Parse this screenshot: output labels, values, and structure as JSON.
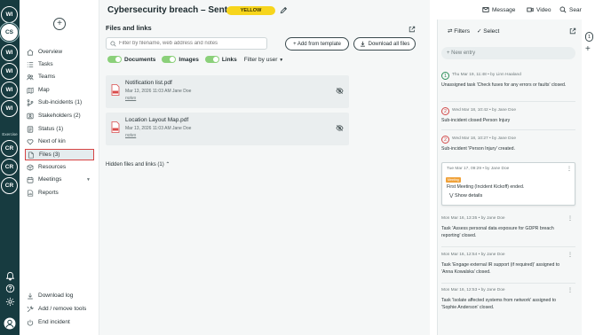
{
  "rail": {
    "avatars_top": [
      "WI",
      "CS",
      "WI",
      "WI",
      "WI",
      "WI"
    ],
    "exercise_label": "Exercise",
    "avatars_exercise": [
      "CR",
      "CR",
      "CR"
    ]
  },
  "sidebar": {
    "items": [
      {
        "label": "Overview",
        "icon": "home-icon"
      },
      {
        "label": "Tasks",
        "icon": "list-icon"
      },
      {
        "label": "Teams",
        "icon": "users-icon"
      },
      {
        "label": "Map",
        "icon": "map-icon"
      },
      {
        "label": "Sub-incidents (1)",
        "icon": "branch-icon"
      },
      {
        "label": "Stakeholders (2)",
        "icon": "stakeholders-icon"
      },
      {
        "label": "Status (1)",
        "icon": "status-icon"
      },
      {
        "label": "Next of kin",
        "icon": "heart-icon"
      },
      {
        "label": "Files (3)",
        "icon": "file-icon"
      },
      {
        "label": "Resources",
        "icon": "box-icon"
      },
      {
        "label": "Meetings",
        "icon": "calendar-icon"
      },
      {
        "label": "Reports",
        "icon": "report-icon"
      }
    ],
    "bottom": [
      {
        "label": "Download log",
        "icon": "download-icon"
      },
      {
        "label": "Add / remove tools",
        "icon": "tools-icon"
      },
      {
        "label": "End incident",
        "icon": "power-icon"
      }
    ]
  },
  "header": {
    "title": "Cybersecurity breach – SentraC...",
    "status_badge": "YELLOW",
    "message": "Message",
    "video": "Video",
    "search": "Search"
  },
  "files": {
    "section_title": "Files and links",
    "search_placeholder": "Filter by filename, web address and notes",
    "add_template": "+ Add from template",
    "download_all": "Download all files",
    "toggles": {
      "documents": "Documents",
      "images": "Images",
      "links": "Links",
      "filter_user": "Filter by user"
    },
    "items": [
      {
        "name": "Notification list.pdf",
        "meta": "Mar 13, 2026 11:03 AM   Jane Doe",
        "notes": "notes"
      },
      {
        "name": "Location Layout Map.pdf",
        "meta": "Mar 13, 2026 11:03 AM   Jane Doe",
        "notes": "notes"
      }
    ],
    "hidden": "Hidden files and links (1)"
  },
  "log": {
    "filters": "Filters",
    "select": "Select",
    "new_entry": "+   New entry",
    "entries": [
      {
        "num": "1",
        "color": "green",
        "meta": "Thu Mar 19, 11:48  •  by Linn Haaland",
        "text": "Unassigned task 'Check fuses for any errors or faults' closed."
      },
      {
        "num": "2",
        "color": "red",
        "meta": "Wed Mar 18, 10:42  •  by Jane Doe",
        "text": "Sub-incident closed:Person Injury"
      },
      {
        "num": "2",
        "color": "red",
        "meta": "Wed Mar 18, 10:27  •  by Jane Doe",
        "text": "Sub-incident 'Person Injury' created."
      },
      {
        "meta": "Tue Mar 17, 09:29  •  by Jane Doe",
        "tag": "Meeting",
        "text": "First Meeting (Incident Kickoff) ended.",
        "details": "Show details"
      },
      {
        "meta": "Mon Mar 16, 13:35  •  by Jane Doe",
        "text": "Task 'Assess personal data exposure for GDPR breach reporting' closed."
      },
      {
        "meta": "Mon Mar 16, 12:54  •  by Jane Doe",
        "text": "Task 'Engage external IR support (if required)' assigned to 'Anna Kowalska' closed."
      },
      {
        "meta": "Mon Mar 16, 12:53  •  by Jane Doe",
        "text": "Task 'Isolate affected systems from network' assigned to 'Sophie Anderson' closed."
      }
    ]
  },
  "side_counter": "1",
  "colors": {
    "rail": "#173b40",
    "badge": "#f7d51c",
    "toggle": "#8bd07a",
    "highlight": "#d64545"
  }
}
